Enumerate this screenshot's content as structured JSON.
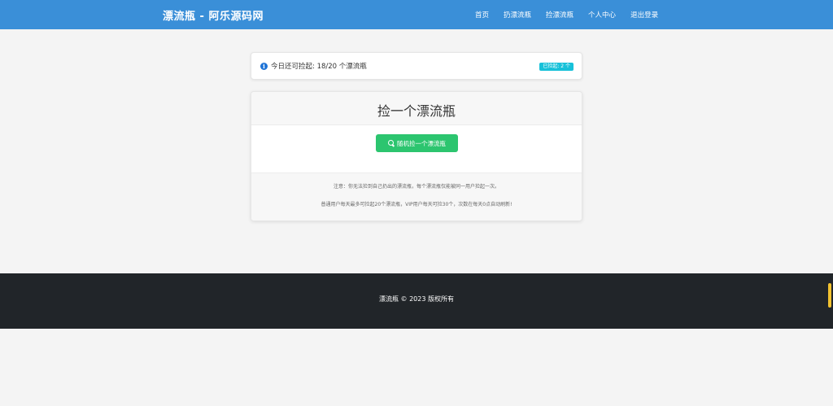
{
  "navbar": {
    "brand": "漂流瓶 - 阿乐源码网",
    "links": [
      "首页",
      "扔漂流瓶",
      "捡漂流瓶",
      "个人中心",
      "退出登录"
    ]
  },
  "info": {
    "icon": "info-circle-icon",
    "text": "今日还可捡起: 18/20 个漂流瓶",
    "badge": "已捡起: 2 个"
  },
  "card": {
    "title": "捡一个漂流瓶",
    "button_icon": "search-icon",
    "button_label": "随机捡一个漂流瓶",
    "note_1": "注意：你无法捡到自己扔出的漂流瓶，每个漂流瓶仅能被同一用户捡起一次。",
    "note_2": "普通用户每天最多可捡起20个漂流瓶，VIP用户每天可捡30个，次数在每天0点自动刷新!"
  },
  "footer": {
    "copyright": "漂流瓶 © 2023 版权所有"
  },
  "colors": {
    "navbar": "#3a8fd8",
    "button": "#2cc56f",
    "badge": "#17c1d9",
    "footer": "#212529"
  }
}
